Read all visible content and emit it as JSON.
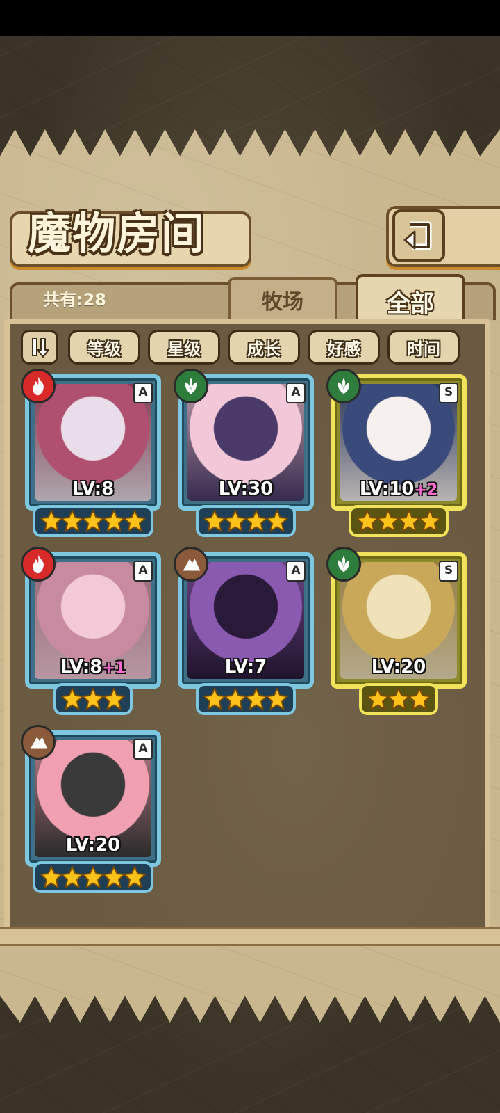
{
  "page": {
    "title": "魔物房间"
  },
  "summary": {
    "count_label": "共有:28"
  },
  "tabs": [
    {
      "label": "牧场",
      "active": false
    },
    {
      "label": "全部",
      "active": true
    }
  ],
  "sort": {
    "buttons": [
      {
        "label": "等级"
      },
      {
        "label": "星级"
      },
      {
        "label": "成长"
      },
      {
        "label": "好感"
      },
      {
        "label": "时间"
      }
    ]
  },
  "monsters": [
    {
      "level": "LV:8",
      "bonus": "",
      "rank": "A",
      "element": "fire",
      "stars": 5
    },
    {
      "level": "LV:30",
      "bonus": "",
      "rank": "A",
      "element": "nature",
      "stars": 4
    },
    {
      "level": "LV:10",
      "bonus": "+2",
      "rank": "S",
      "element": "nature",
      "stars": 4
    },
    {
      "level": "LV:8",
      "bonus": "+1",
      "rank": "A",
      "element": "fire",
      "stars": 3
    },
    {
      "level": "LV:7",
      "bonus": "",
      "rank": "A",
      "element": "earth",
      "stars": 4
    },
    {
      "level": "LV:20",
      "bonus": "",
      "rank": "S",
      "element": "nature",
      "stars": 3
    },
    {
      "level": "LV:20",
      "bonus": "",
      "rank": "A",
      "element": "earth",
      "stars": 5
    }
  ],
  "icons": {
    "back": "back-arrow-icon",
    "sort_toggle": "sort-order-icon",
    "star": "star-icon"
  },
  "colors": {
    "frame_a": "#7ec7e0",
    "frame_s": "#f0e25a",
    "fire": "#d92a2a",
    "nature": "#2f7d3c",
    "earth": "#8a5a3a"
  }
}
